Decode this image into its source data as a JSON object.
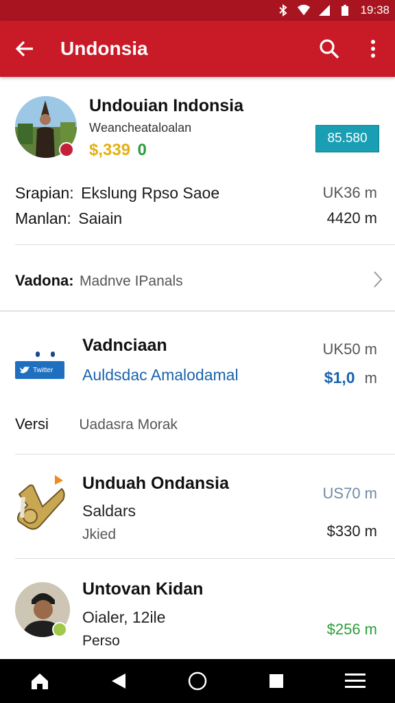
{
  "status_bar": {
    "time": "19:38"
  },
  "app_bar": {
    "title": "Undonsia"
  },
  "featured": {
    "title": "Undouian Indonsia",
    "subtitle": "Wеаnchеаtаlоаlаn",
    "price_old": "$,339",
    "price_new": "0",
    "button_label": "85.580"
  },
  "details": [
    {
      "label": "Srapian:",
      "value": "Ekslung Rpso Saoe",
      "meta": "UK36 m"
    },
    {
      "label": "Manlan:",
      "value": "Saiain",
      "meta": "4420 m"
    }
  ],
  "vadona_row": {
    "label": "Vadona:",
    "value": "Madnve IPanals"
  },
  "items": [
    {
      "title": "Vadnciaan",
      "subtitle": "Auldsdac Amalodamal",
      "meta_top": "UK50 m",
      "meta_bottom_value": "$1,0",
      "meta_bottom_unit": "m",
      "thumb_text": "Twitter"
    },
    {
      "title": "Unduah Ondansia",
      "subtitle": "Saldars",
      "extra": "Jkied",
      "meta_top": "US70 m",
      "meta_bottom": "$330 m"
    },
    {
      "title": "Untovan Kidan",
      "subtitle": "Oialer, 12ile",
      "extra": "Perso",
      "meta_bottom": "$256 m"
    }
  ],
  "versi_row": {
    "label": "Versi",
    "value": "Uadasra Morak"
  },
  "colors": {
    "app_bar": "#c91a27",
    "status_bar": "#a8141f",
    "button": "#1a9eb3",
    "link_blue": "#1a63ad",
    "green": "#2a9d3a"
  }
}
